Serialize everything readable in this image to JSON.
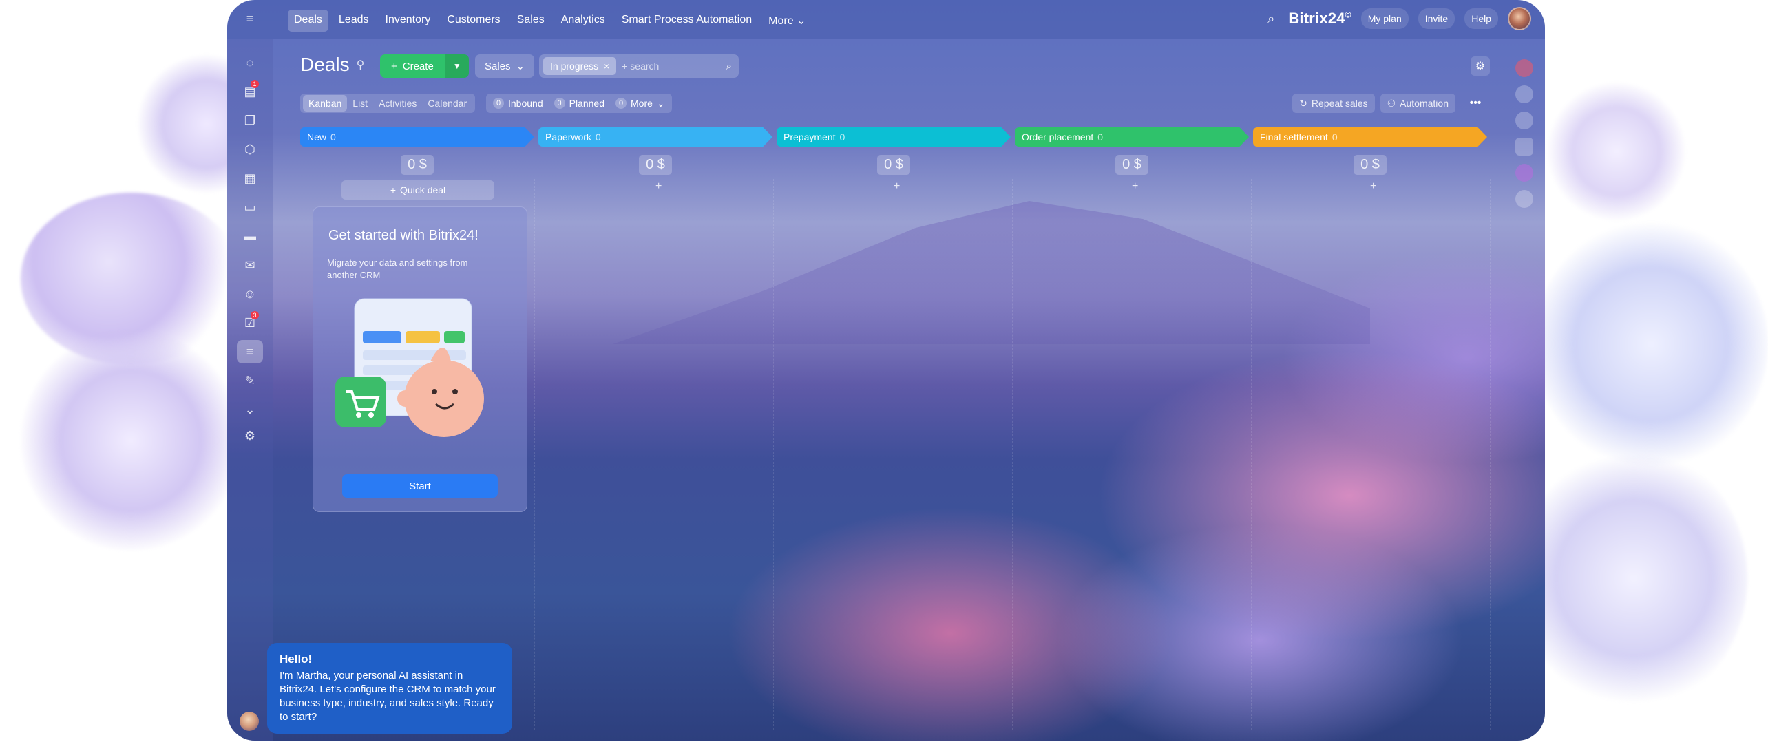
{
  "topbar": {
    "menu_icon": "menu-icon",
    "nav": [
      "Deals",
      "Leads",
      "Inventory",
      "Customers",
      "Sales",
      "Analytics",
      "Smart Process Automation",
      "More"
    ],
    "brand": "Bitrix24",
    "brand_mark": "©",
    "my_plan": "My plan",
    "invite": "Invite",
    "help": "Help"
  },
  "sidebar": {
    "badges": {
      "feed": "1",
      "tasks": "3"
    }
  },
  "page": {
    "title": "Deals",
    "create_label": "Create",
    "pipeline_label": "Sales",
    "filter_chip": "In progress",
    "search_placeholder": "+ search"
  },
  "views": [
    "Kanban",
    "List",
    "Activities",
    "Calendar"
  ],
  "counters": [
    {
      "count": "0",
      "label": "Inbound"
    },
    {
      "count": "0",
      "label": "Planned"
    },
    {
      "count": "0",
      "label": "More"
    }
  ],
  "tools": {
    "repeat_sales": "Repeat sales",
    "automation": "Automation"
  },
  "stages": [
    {
      "name": "New",
      "count": "0",
      "color": "#2b86f5",
      "amount": "0 $"
    },
    {
      "name": "Paperwork",
      "count": "0",
      "color": "#37b2f3",
      "amount": "0 $"
    },
    {
      "name": "Prepayment",
      "count": "0",
      "color": "#0cbfd4",
      "amount": "0 $"
    },
    {
      "name": "Order placement",
      "count": "0",
      "color": "#2fc26b",
      "amount": "0 $"
    },
    {
      "name": "Final settlement",
      "count": "0",
      "color": "#f5a623",
      "amount": "0 $"
    }
  ],
  "quick_deal": "Quick deal",
  "plus": "+",
  "onboarding": {
    "title": "Get started with Bitrix24!",
    "text": "Migrate your data and settings from another CRM",
    "button": "Start"
  },
  "assistant": {
    "greeting": "Hello!",
    "text": "I'm Martha, your personal AI assistant in Bitrix24. Let's configure the CRM to match your business type, industry, and sales style. Ready to start?"
  }
}
